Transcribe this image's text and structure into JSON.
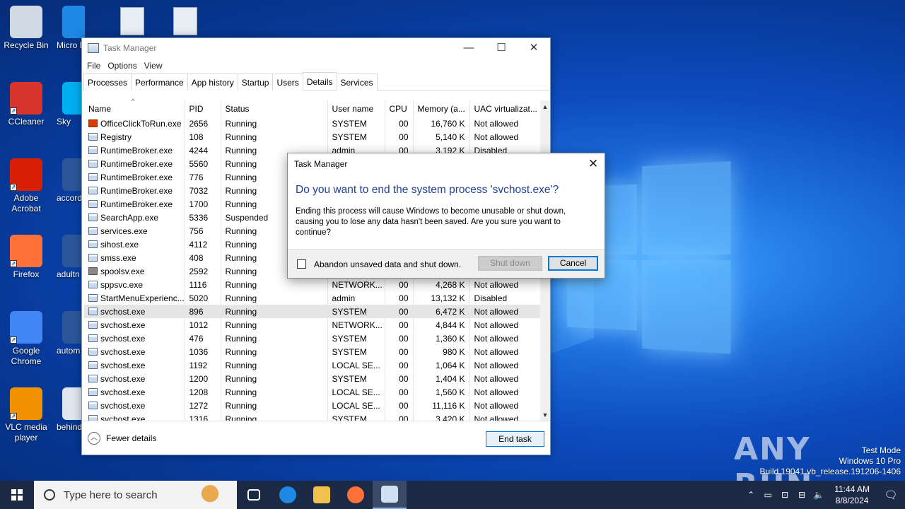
{
  "desktop": {
    "icons": [
      {
        "label": "Recycle Bin",
        "color": "#cfd8e3"
      },
      {
        "label": "CCleaner",
        "color": "#d9342b"
      },
      {
        "label": "Adobe Acrobat",
        "color": "#d81e05"
      },
      {
        "label": "Firefox",
        "color": "#ff7139"
      },
      {
        "label": "Google Chrome",
        "color": "#4285f4"
      },
      {
        "label": "VLC media player",
        "color": "#f39200"
      }
    ],
    "partial_icons": [
      {
        "label": "Micro Edg",
        "color": "#1e88e5"
      },
      {
        "label": "Sky",
        "color": "#00aff0"
      },
      {
        "label": "accord",
        "color": "#2b579a"
      },
      {
        "label": "adultn",
        "color": "#2b579a"
      },
      {
        "label": "autom",
        "color": "#2b579a"
      },
      {
        "label": "behind",
        "color": "#dfe6ee"
      }
    ],
    "watermark": {
      "logo": "ANY RUN",
      "line1": "Test Mode",
      "line2": "Windows 10 Pro",
      "line3": "Build 19041.vb_release.191206-1406"
    }
  },
  "taskmanager": {
    "title": "Task Manager",
    "controls": {
      "minimize": "—",
      "maximize": "☐",
      "close": "✕"
    },
    "menu": [
      "File",
      "Options",
      "View"
    ],
    "tabs": [
      "Processes",
      "Performance",
      "App history",
      "Startup",
      "Users",
      "Details",
      "Services"
    ],
    "active_tab": "Details",
    "columns": [
      "Name",
      "PID",
      "Status",
      "User name",
      "CPU",
      "Memory (a...",
      "UAC virtualizat..."
    ],
    "rows": [
      {
        "name": "OfficeClickToRun.exe",
        "pid": "2656",
        "status": "Running",
        "user": "SYSTEM",
        "cpu": "00",
        "mem": "16,760 K",
        "uac": "Not allowed",
        "icon": "office"
      },
      {
        "name": "Registry",
        "pid": "108",
        "status": "Running",
        "user": "SYSTEM",
        "cpu": "00",
        "mem": "5,140 K",
        "uac": "Not allowed",
        "icon": "app"
      },
      {
        "name": "RuntimeBroker.exe",
        "pid": "4244",
        "status": "Running",
        "user": "admin",
        "cpu": "00",
        "mem": "3,192 K",
        "uac": "Disabled",
        "icon": "app"
      },
      {
        "name": "RuntimeBroker.exe",
        "pid": "5560",
        "status": "Running",
        "user": "",
        "cpu": "",
        "mem": "",
        "uac": "",
        "icon": "app"
      },
      {
        "name": "RuntimeBroker.exe",
        "pid": "776",
        "status": "Running",
        "user": "",
        "cpu": "",
        "mem": "",
        "uac": "",
        "icon": "app"
      },
      {
        "name": "RuntimeBroker.exe",
        "pid": "7032",
        "status": "Running",
        "user": "",
        "cpu": "",
        "mem": "",
        "uac": "",
        "icon": "app"
      },
      {
        "name": "RuntimeBroker.exe",
        "pid": "1700",
        "status": "Running",
        "user": "",
        "cpu": "",
        "mem": "",
        "uac": "",
        "icon": "app"
      },
      {
        "name": "SearchApp.exe",
        "pid": "5336",
        "status": "Suspended",
        "user": "",
        "cpu": "",
        "mem": "",
        "uac": "",
        "icon": "app"
      },
      {
        "name": "services.exe",
        "pid": "756",
        "status": "Running",
        "user": "",
        "cpu": "",
        "mem": "",
        "uac": "",
        "icon": "app"
      },
      {
        "name": "sihost.exe",
        "pid": "4112",
        "status": "Running",
        "user": "",
        "cpu": "",
        "mem": "",
        "uac": "",
        "icon": "app"
      },
      {
        "name": "smss.exe",
        "pid": "408",
        "status": "Running",
        "user": "",
        "cpu": "",
        "mem": "",
        "uac": "",
        "icon": "app"
      },
      {
        "name": "spoolsv.exe",
        "pid": "2592",
        "status": "Running",
        "user": "",
        "cpu": "",
        "mem": "",
        "uac": "",
        "icon": "printer"
      },
      {
        "name": "sppsvc.exe",
        "pid": "1116",
        "status": "Running",
        "user": "NETWORK...",
        "cpu": "00",
        "mem": "4,268 K",
        "uac": "Not allowed",
        "icon": "app"
      },
      {
        "name": "StartMenuExperienc...",
        "pid": "5020",
        "status": "Running",
        "user": "admin",
        "cpu": "00",
        "mem": "13,132 K",
        "uac": "Disabled",
        "icon": "app"
      },
      {
        "name": "svchost.exe",
        "pid": "896",
        "status": "Running",
        "user": "SYSTEM",
        "cpu": "00",
        "mem": "6,472 K",
        "uac": "Not allowed",
        "icon": "app",
        "selected": true
      },
      {
        "name": "svchost.exe",
        "pid": "1012",
        "status": "Running",
        "user": "NETWORK...",
        "cpu": "00",
        "mem": "4,844 K",
        "uac": "Not allowed",
        "icon": "app"
      },
      {
        "name": "svchost.exe",
        "pid": "476",
        "status": "Running",
        "user": "SYSTEM",
        "cpu": "00",
        "mem": "1,360 K",
        "uac": "Not allowed",
        "icon": "app"
      },
      {
        "name": "svchost.exe",
        "pid": "1036",
        "status": "Running",
        "user": "SYSTEM",
        "cpu": "00",
        "mem": "980 K",
        "uac": "Not allowed",
        "icon": "app"
      },
      {
        "name": "svchost.exe",
        "pid": "1192",
        "status": "Running",
        "user": "LOCAL SE...",
        "cpu": "00",
        "mem": "1,064 K",
        "uac": "Not allowed",
        "icon": "app"
      },
      {
        "name": "svchost.exe",
        "pid": "1200",
        "status": "Running",
        "user": "SYSTEM",
        "cpu": "00",
        "mem": "1,404 K",
        "uac": "Not allowed",
        "icon": "app"
      },
      {
        "name": "svchost.exe",
        "pid": "1208",
        "status": "Running",
        "user": "LOCAL SE...",
        "cpu": "00",
        "mem": "1,560 K",
        "uac": "Not allowed",
        "icon": "app"
      },
      {
        "name": "svchost.exe",
        "pid": "1272",
        "status": "Running",
        "user": "LOCAL SE...",
        "cpu": "00",
        "mem": "11,116 K",
        "uac": "Not allowed",
        "icon": "app"
      },
      {
        "name": "svchost.exe",
        "pid": "1316",
        "status": "Running",
        "user": "SYSTEM",
        "cpu": "00",
        "mem": "3,420 K",
        "uac": "Not allowed",
        "icon": "app"
      }
    ],
    "footer": {
      "fewer_details": "Fewer details",
      "end_task": "End task"
    }
  },
  "dialog": {
    "title": "Task Manager",
    "heading": "Do you want to end the system process 'svchost.exe'?",
    "body": "Ending this process will cause Windows to become unusable or shut down, causing you to lose any data hasn't been saved. Are you sure you want to continue?",
    "checkbox_label": "Abandon unsaved data and shut down.",
    "checkbox_checked": false,
    "shutdown_label": "Shut down",
    "cancel_label": "Cancel",
    "close": "✕"
  },
  "taskbar": {
    "search_placeholder": "Type here to search",
    "apps": [
      {
        "name": "task-view",
        "color": "#ffffff"
      },
      {
        "name": "edge",
        "color": "#1e88e5"
      },
      {
        "name": "file-explorer",
        "color": "#f0c14b"
      },
      {
        "name": "firefox",
        "color": "#ff7139"
      },
      {
        "name": "task-manager",
        "color": "#cfe0f3",
        "active": true
      }
    ],
    "tray_chevron": "⌃",
    "time": "11:44 AM",
    "date": "8/8/2024",
    "notification": "🗨"
  }
}
